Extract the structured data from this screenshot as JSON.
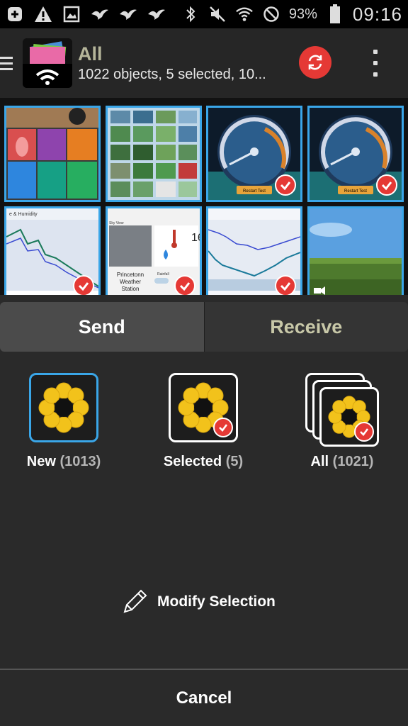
{
  "status_bar": {
    "battery_percent": "93%",
    "time": "09:16"
  },
  "app_bar": {
    "title": "All",
    "subtitle": "1022 objects, 5 selected, 10..."
  },
  "thumbnails": [
    {
      "name": "thumbnail-apps-screenshot",
      "selected": true
    },
    {
      "name": "thumbnail-photo-grid",
      "selected": true
    },
    {
      "name": "thumbnail-speedometer-1",
      "selected": true
    },
    {
      "name": "thumbnail-speedometer-2",
      "selected": true
    },
    {
      "name": "thumbnail-humidity-chart",
      "selected": true
    },
    {
      "name": "thumbnail-weather-station",
      "selected": true
    },
    {
      "name": "thumbnail-temperature-chart",
      "selected": true
    },
    {
      "name": "thumbnail-landscape-video",
      "selected": false
    }
  ],
  "thumb_text": {
    "humidity_title": "e & Humidity",
    "weather_line1": "Princetonn",
    "weather_line2": "Weather",
    "weather_line3": "Station",
    "weather_temp": "16",
    "sky_view": "Sky View",
    "rainfall": "Rainfall",
    "speed_button": "Restart Test"
  },
  "sheet": {
    "tabs": [
      {
        "label": "Send",
        "active": true
      },
      {
        "label": "Receive",
        "active": false
      }
    ],
    "options": {
      "new": {
        "label": "New",
        "count": "(1013)"
      },
      "selected": {
        "label": "Selected",
        "count": "(5)"
      },
      "all": {
        "label": "All",
        "count": "(1021)"
      }
    },
    "modify_label": "Modify Selection",
    "cancel_label": "Cancel"
  },
  "colors": {
    "accent_blue": "#3aa6e8",
    "accent_red": "#e53935",
    "flower_yellow": "#f2c21b"
  }
}
